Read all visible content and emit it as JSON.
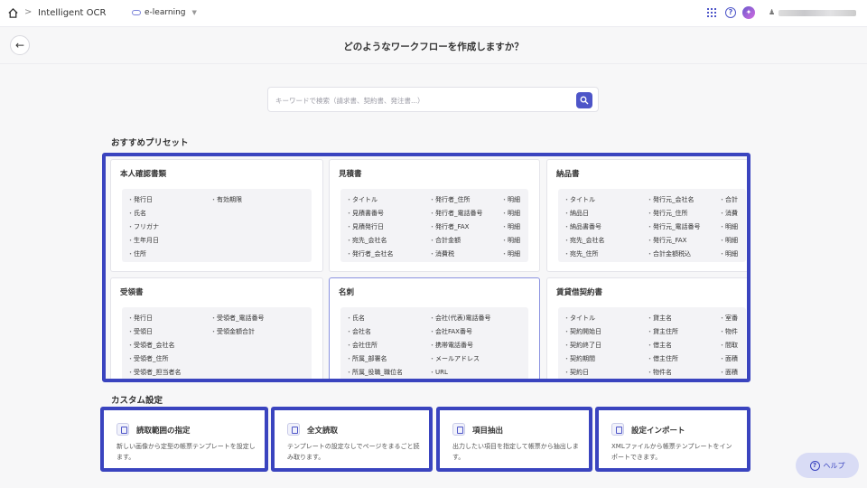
{
  "topbar": {
    "app_name": "Intelligent OCR",
    "workspace": "e-learning"
  },
  "page": {
    "title": "どのようなワークフローを作成しますか？"
  },
  "search": {
    "placeholder": "キーワードで検索（請求書、契約書、発注書...）"
  },
  "presets": {
    "section_title": "おすすめプリセット",
    "cards": [
      {
        "title": "本人確認書類",
        "cols": [
          [
            "発行日",
            "氏名",
            "フリガナ",
            "生年月日",
            "住所"
          ],
          [
            "有効期限"
          ]
        ]
      },
      {
        "title": "見積書",
        "cols": [
          [
            "タイトル",
            "見積書番号",
            "見積発行日",
            "宛先_会社名",
            "発行者_会社名"
          ],
          [
            "発行者_住所",
            "発行者_電話番号",
            "発行者_FAX",
            "合計金額",
            "消費税"
          ],
          [
            "明細",
            "明細",
            "明細",
            "明細",
            "明細"
          ]
        ]
      },
      {
        "title": "納品書",
        "cols": [
          [
            "タイトル",
            "納品日",
            "納品書番号",
            "宛先_会社名",
            "宛先_住所"
          ],
          [
            "発行元_会社名",
            "発行元_住所",
            "発行元_電話番号",
            "発行元_FAX",
            "合計金額税込"
          ],
          [
            "合計",
            "消費",
            "明細",
            "明細",
            "明細"
          ]
        ]
      },
      {
        "title": "受領書",
        "cols": [
          [
            "発行日",
            "受領日",
            "受領者_会社名",
            "受領者_住所",
            "受領者_担当者名"
          ],
          [
            "受領者_電話番号",
            "受領金額合計"
          ]
        ]
      },
      {
        "title": "名刺",
        "cols": [
          [
            "氏名",
            "会社名",
            "会社住所",
            "所属_部署名",
            "所属_役職_職位名"
          ],
          [
            "会社(代表)電話番号",
            "会社FAX番号",
            "携帯電話番号",
            "メールアドレス",
            "URL"
          ]
        ]
      },
      {
        "title": "賃貸借契約書",
        "cols": [
          [
            "タイトル",
            "契約開始日",
            "契約終了日",
            "契約期間",
            "契約日"
          ],
          [
            "貸主名",
            "貸主住所",
            "借主名",
            "借主住所",
            "物件名"
          ],
          [
            "室番",
            "物件",
            "間取",
            "面積",
            "面積"
          ]
        ]
      }
    ]
  },
  "custom": {
    "section_title": "カスタム設定",
    "items": [
      {
        "label": "読取範囲の指定",
        "desc": "新しい画像から定型の帳票テンプレートを設定します。"
      },
      {
        "label": "全文読取",
        "desc": "テンプレートの設定なしでページをまるごと読み取ります。"
      },
      {
        "label": "項目抽出",
        "desc": "出力したい項目を指定して帳票から抽出します。"
      },
      {
        "label": "設定インポート",
        "desc": "XMLファイルから帳票テンプレートをインポートできます。"
      }
    ]
  },
  "help_button": {
    "label": "ヘルプ"
  },
  "colors": {
    "accent": "#4d55c8",
    "highlight_frame": "#3a44bf"
  },
  "icons": [
    "home-icon",
    "chevron-right-icon",
    "apps-grid-icon",
    "help-circle-icon",
    "ai-assistant-icon",
    "user-icon",
    "back-arrow-icon",
    "search-icon",
    "crop-icon",
    "text-lines-icon",
    "extract-icon",
    "import-icon"
  ]
}
